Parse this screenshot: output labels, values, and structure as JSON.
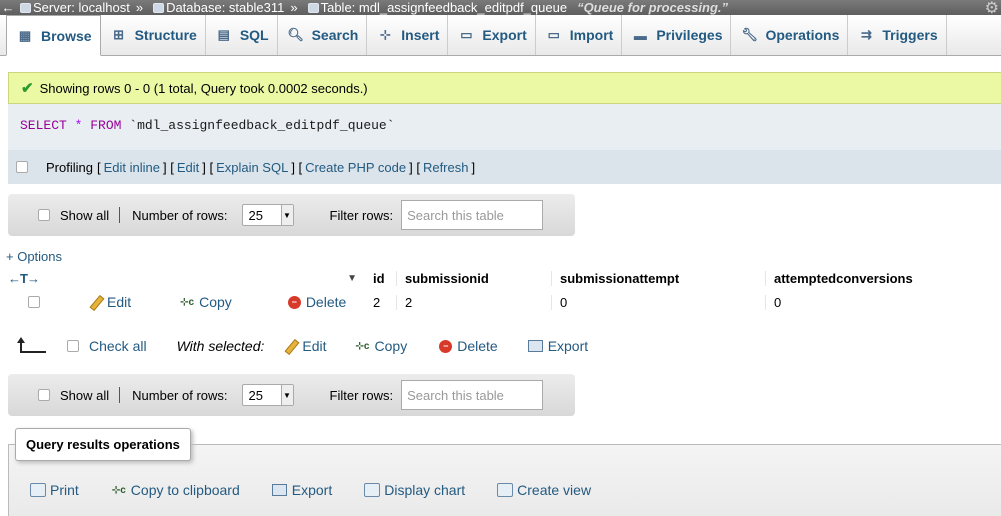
{
  "breadcrumb": {
    "server": "Server: localhost",
    "database": "Database: stable311",
    "table": "Table: mdl_assignfeedback_editpdf_queue",
    "comment": "“Queue for processing.”",
    "separator": "»"
  },
  "tabs": [
    {
      "label": "Browse",
      "icon": "browse-icon",
      "active": true
    },
    {
      "label": "Structure",
      "icon": "structure-icon"
    },
    {
      "label": "SQL",
      "icon": "sql-icon"
    },
    {
      "label": "Search",
      "icon": "search-icon"
    },
    {
      "label": "Insert",
      "icon": "insert-icon"
    },
    {
      "label": "Export",
      "icon": "export-icon"
    },
    {
      "label": "Import",
      "icon": "import-icon"
    },
    {
      "label": "Privileges",
      "icon": "privileges-icon"
    },
    {
      "label": "Operations",
      "icon": "wrench-icon"
    },
    {
      "label": "Triggers",
      "icon": "triggers-icon"
    }
  ],
  "message": "Showing rows 0 - 0 (1 total, Query took 0.0002 seconds.)",
  "sql": {
    "select": "SELECT",
    "star": "*",
    "from": "FROM",
    "table": "`mdl_assignfeedback_editpdf_queue`"
  },
  "profiling": {
    "label": "Profiling",
    "links": [
      "Edit inline",
      "Edit",
      "Explain SQL",
      "Create PHP code",
      "Refresh"
    ]
  },
  "nav": {
    "show_all": "Show all",
    "rows_label": "Number of rows:",
    "rows_value": "25",
    "filter_label": "Filter rows:",
    "filter_placeholder": "Search this table"
  },
  "options_link": "+ Options",
  "table": {
    "arrows": "←T→",
    "columns": [
      "id",
      "submissionid",
      "submissionattempt",
      "attemptedconversions"
    ],
    "rows": [
      {
        "id": "2",
        "submissionid": "2",
        "submissionattempt": "0",
        "attemptedconversions": "0"
      }
    ],
    "row_actions": {
      "edit": "Edit",
      "copy": "Copy",
      "delete": "Delete"
    }
  },
  "with_selected": {
    "check_all": "Check all",
    "label": "With selected:",
    "edit": "Edit",
    "copy": "Copy",
    "delete": "Delete",
    "export": "Export"
  },
  "query_ops": {
    "title": "Query results operations",
    "items": [
      "Print",
      "Copy to clipboard",
      "Export",
      "Display chart",
      "Create view"
    ]
  }
}
